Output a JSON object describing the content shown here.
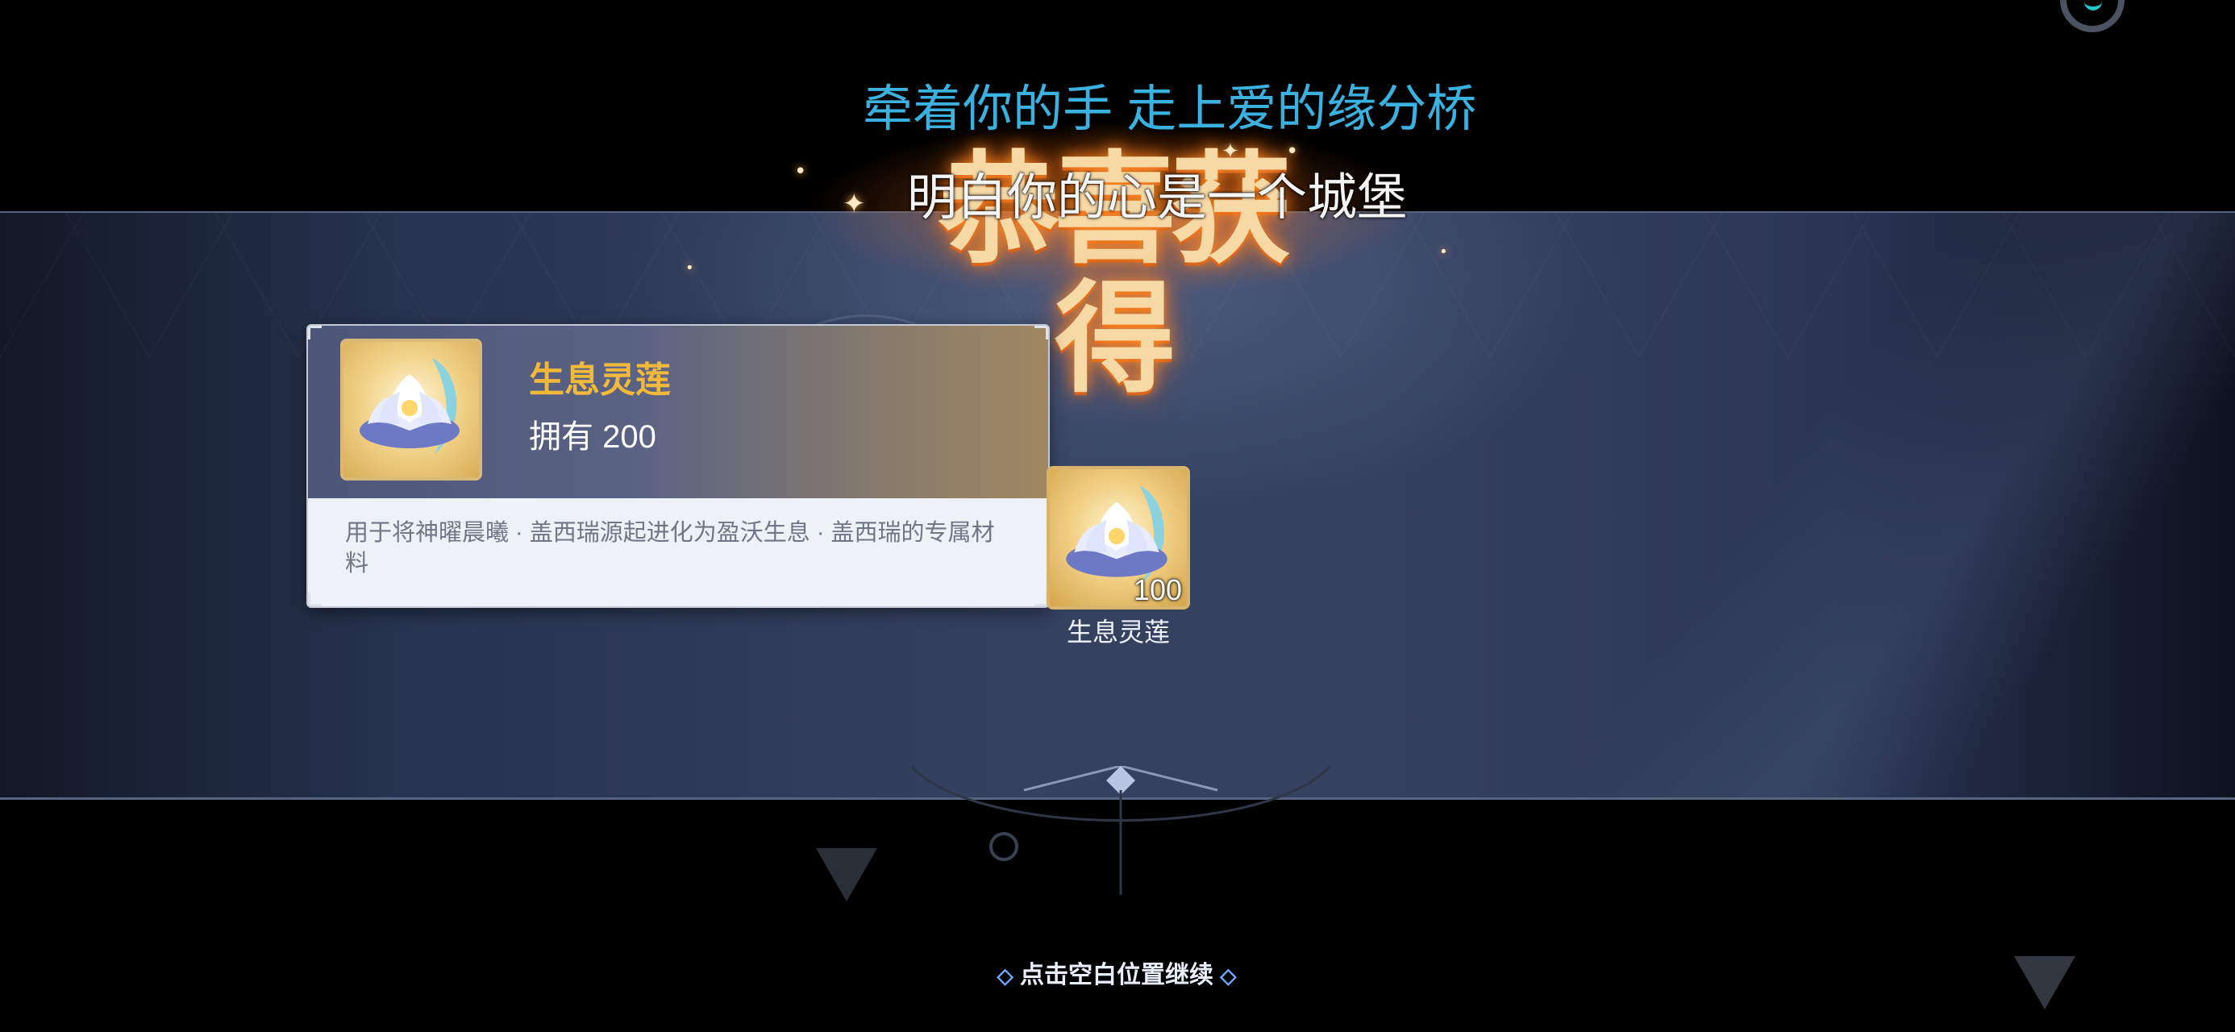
{
  "title": "恭喜获得",
  "lyrics": {
    "line1": "牵着你的手 走上爱的缘分桥",
    "line2": "明白你的心是一个城堡"
  },
  "item_card": {
    "name": "生息灵莲",
    "owned_label": "拥有 200",
    "description": "用于将神曜晨曦 · 盖西瑞源起进化为盈沃生息 · 盖西瑞的专属材料",
    "icon": "white-lotus-icon"
  },
  "reward": {
    "name": "生息灵莲",
    "quantity": "100",
    "icon": "white-lotus-icon"
  },
  "footer": {
    "continue_text": "点击空白位置继续",
    "left_marker": "◇",
    "right_marker": "◇"
  },
  "colors": {
    "item_name": "#f0b93c",
    "lyric_primary": "#3ab1de",
    "title_glow": "#ff8c28",
    "banner": "#34415f"
  }
}
